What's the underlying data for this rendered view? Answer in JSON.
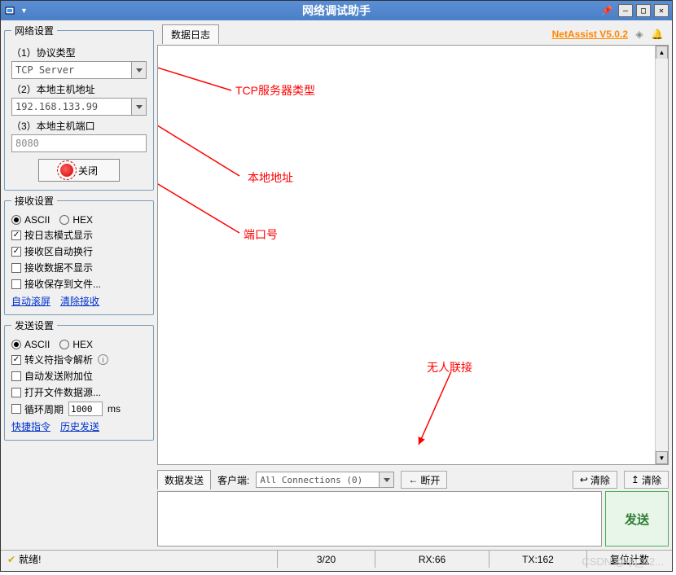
{
  "title": "网络调试助手",
  "version_link": "NetAssist V5.0.2",
  "network_settings": {
    "legend": "网络设置",
    "protocol_label": "（1）协议类型",
    "protocol_value": "TCP Server",
    "host_label": "（2）本地主机地址",
    "host_value": "192.168.133.99",
    "port_label": "（3）本地主机端口",
    "port_value": "8080",
    "close_btn": "关闭"
  },
  "recv_settings": {
    "legend": "接收设置",
    "ascii": "ASCII",
    "hex": "HEX",
    "log_mode": "按日志模式显示",
    "auto_wrap": "接收区自动换行",
    "hide_recv": "接收数据不显示",
    "save_file": "接收保存到文件...",
    "auto_scroll": "自动滚屏",
    "clear_recv": "清除接收"
  },
  "send_settings": {
    "legend": "发送设置",
    "ascii": "ASCII",
    "hex": "HEX",
    "escape": "转义符指令解析",
    "auto_append": "自动发送附加位",
    "open_file": "打开文件数据源...",
    "loop_label_pre": "循环周期",
    "loop_value": "1000",
    "loop_unit": "ms",
    "quick_cmd": "快捷指令",
    "history": "历史发送"
  },
  "log_tab": "数据日志",
  "send_area": {
    "tab": "数据发送",
    "client_label": "客户端:",
    "client_value": "All Connections (0)",
    "disconnect": "断开",
    "clear1": "清除",
    "clear2": "清除",
    "send_btn": "发送"
  },
  "status": {
    "ready": "就绪!",
    "pages": "3/20",
    "rx": "RX:66",
    "tx": "TX:162",
    "reset": "复位计数"
  },
  "annotations": {
    "tcp_type": "TCP服务器类型",
    "local_addr": "本地地址",
    "port_no": "端口号",
    "no_conn": "无人联接"
  },
  "watermark": "CSDN @qq_42..."
}
